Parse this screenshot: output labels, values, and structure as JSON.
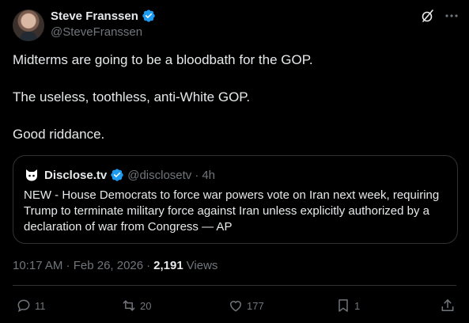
{
  "author": {
    "name": "Steve Franssen",
    "handle": "@SteveFranssen"
  },
  "tweet": {
    "lines": [
      "Midterms are going to be a bloodbath for the GOP.",
      "The useless, toothless, anti-White GOP.",
      "Good riddance."
    ]
  },
  "quoted": {
    "name": "Disclose.tv",
    "handle": "@disclosetv",
    "separator": "·",
    "time": "4h",
    "text": "NEW - House Democrats to force war powers vote on Iran next week, requiring Trump to terminate military force against Iran unless explicitly authorized by a declaration of war from Congress — AP"
  },
  "meta": {
    "timestamp": "10:17 AM · Feb 26, 2026",
    "separator": "·",
    "views_count": "2,191",
    "views_label": "Views"
  },
  "stats": {
    "replies": "11",
    "reposts": "20",
    "likes": "177",
    "bookmarks": "1"
  },
  "colors": {
    "background": "#000000",
    "text": "#e7e9ea",
    "muted": "#71767b",
    "border": "#2f3336",
    "verified": "#1d9bf0"
  },
  "icons": [
    "verified-badge-icon",
    "grok-icon",
    "more-icon",
    "disclose-logo-icon",
    "reply-icon",
    "repost-icon",
    "like-icon",
    "bookmark-icon",
    "share-icon"
  ]
}
